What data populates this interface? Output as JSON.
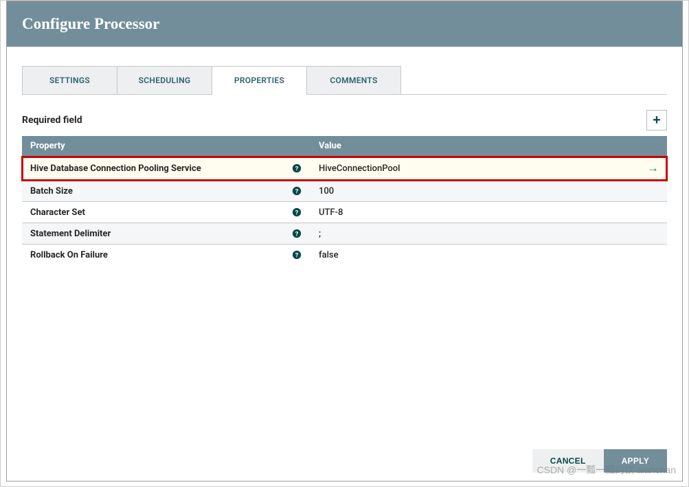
{
  "title": "Configure Processor",
  "tabs": [
    {
      "label": "SETTINGS",
      "active": false
    },
    {
      "label": "SCHEDULING",
      "active": false
    },
    {
      "label": "PROPERTIES",
      "active": true
    },
    {
      "label": "COMMENTS",
      "active": false
    }
  ],
  "required_label": "Required field",
  "add_icon_label": "+",
  "columns": {
    "property": "Property",
    "value": "Value"
  },
  "rows": [
    {
      "property": "Hive Database Connection Pooling Service",
      "value": "HiveConnectionPool",
      "has_goto": true,
      "highlight": true
    },
    {
      "property": "Batch Size",
      "value": "100",
      "has_goto": false,
      "highlight": false
    },
    {
      "property": "Character Set",
      "value": "UTF-8",
      "has_goto": false,
      "highlight": false
    },
    {
      "property": "Statement Delimiter",
      "value": ";",
      "has_goto": false,
      "highlight": false
    },
    {
      "property": "Rollback On Failure",
      "value": "false",
      "has_goto": false,
      "highlight": false
    }
  ],
  "footer": {
    "cancel": "CANCEL",
    "apply": "APPLY"
  },
  "help_glyph": "?",
  "goto_glyph": "→",
  "watermark": "CSDN @一瓢一瓢的饮 alanchan"
}
